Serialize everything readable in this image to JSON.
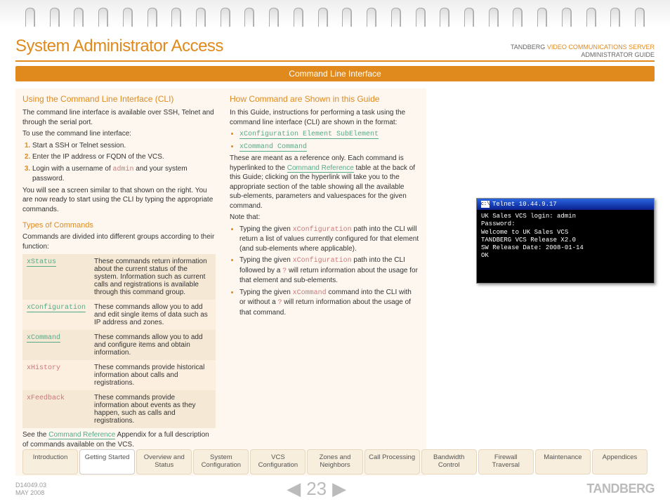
{
  "header": {
    "title": "System Administrator Access",
    "product_prefix": "TANDBERG",
    "product": "VIDEO COMMUNICATIONS SERVER",
    "subtitle": "ADMINISTRATOR GUIDE"
  },
  "section_bar": "Command Line Interface",
  "col1": {
    "h_cli": "Using the Command Line Interface (CLI)",
    "p_intro": "The command line interface is available over SSH, Telnet and through the serial port.",
    "p_use": "To use the command line interface:",
    "steps": [
      "Start a SSH or Telnet session.",
      "Enter the IP address or FQDN of the VCS.",
      {
        "pre": "Login with a username of ",
        "code": "admin",
        "post": " and your system password."
      }
    ],
    "p_after": "You will see a screen similar to that shown on the right.  You are now ready to start using the CLI by typing the appropriate commands.",
    "h_types": "Types of Commands",
    "p_types": "Commands are divided into different groups according to their function:",
    "table": [
      {
        "cmd": "xStatus",
        "link": true,
        "desc": "These commands return information about the current status of the system. Information such as current calls and registrations is available through this command group."
      },
      {
        "cmd": "xConfiguration",
        "link": true,
        "desc": "These commands allow you to add and edit single items of data such as IP address and zones."
      },
      {
        "cmd": "xCommand",
        "link": true,
        "desc": "These commands allow you to add and configure items and obtain information."
      },
      {
        "cmd": "xHistory",
        "link": false,
        "desc": "These commands provide historical information about calls and registrations."
      },
      {
        "cmd": "xFeedback",
        "link": false,
        "desc": "These commands provide information about events as they happen, such as calls and registrations."
      }
    ],
    "see_pre": "See the ",
    "see_link": "Command Reference",
    "see_post": " Appendix for a full description of commands available on the VCS."
  },
  "col2": {
    "h": "How Command are Shown in this Guide",
    "p_intro": "In this Guide, instructions for performing a task using the command line interface (CLI) are shown in the format:",
    "fmt1": "xConfiguration Element SubElement",
    "fmt2": "xCommand Command",
    "p_ref_pre": "These are meant as a reference only. Each command is hyperlinked to the ",
    "p_ref_link": "Command Reference",
    "p_ref_post": " table at the back of this Guide; clicking on the hyperlink will take you to the appropriate section of the table showing all the available sub-elements, parameters and valuespaces for the given command.",
    "note_label": "Note that:",
    "notes": [
      {
        "pre": "Typing the given ",
        "code": "xConfiguration",
        "post": " path into the CLI will return a list of values currently configured for that element (and sub-elements where applicable)."
      },
      {
        "pre": "Typing the given ",
        "code": "xConfiguration",
        "mid": " path into the CLI followed by a ",
        "code2": "?",
        "post": " will return information about the usage for that element and sub-elements."
      },
      {
        "pre": "Typing the given ",
        "code": "xCommand",
        "mid": " command into the CLI with or without a ",
        "code2": "?",
        "post": " will return information about the usage of that command."
      }
    ]
  },
  "terminal": {
    "title": "Telnet 10.44.9.17",
    "lines": "UK Sales VCS login: admin\nPassword:\nWelcome to UK Sales VCS\nTANDBERG VCS Release X2.0\nSW Release Date: 2008-01-14\nOK"
  },
  "tabs": [
    "Introduction",
    "Getting Started",
    "Overview and Status",
    "System Configuration",
    "VCS Configuration",
    "Zones and Neighbors",
    "Call Processing",
    "Bandwidth Control",
    "Firewall Traversal",
    "Maintenance",
    "Appendices"
  ],
  "active_tab": 1,
  "footer": {
    "doc_id": "D14049.03",
    "date": "MAY 2008",
    "page": "23",
    "brand": "TANDBERG"
  }
}
